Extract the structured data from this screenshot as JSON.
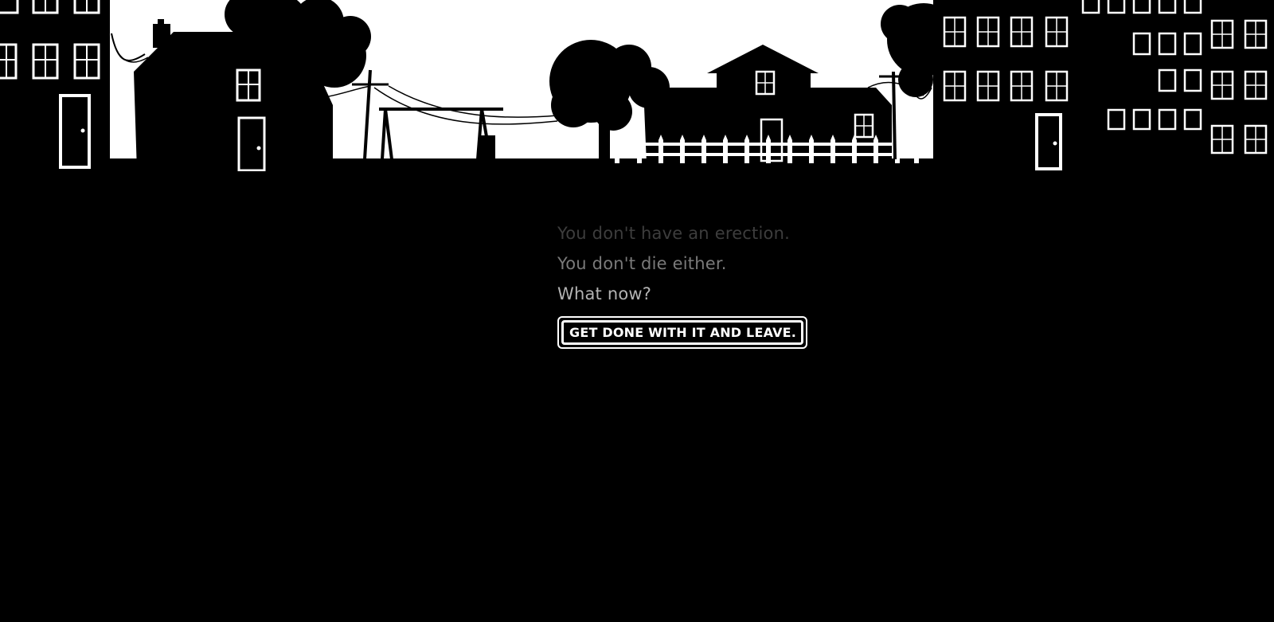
{
  "scene": {
    "lines": [
      {
        "text": "You don't have an erection."
      },
      {
        "text": "You don't die either."
      },
      {
        "text": "What now?"
      }
    ],
    "choice": {
      "label": "GET DONE WITH IT AND LEAVE."
    }
  },
  "colors": {
    "background": "#000000",
    "sky": "#ffffff",
    "line_1": "#3d3d3d",
    "line_2": "#7a7a7a",
    "line_3": "#b3b3b3",
    "choice": "#ffffff"
  }
}
